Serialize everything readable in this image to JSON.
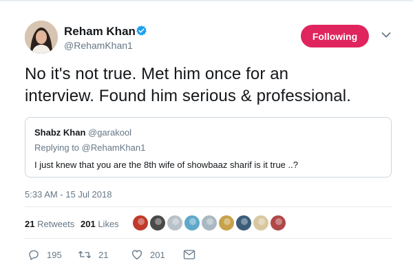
{
  "author": {
    "name": "Reham Khan",
    "handle": "@RehamKhan1",
    "verified": true,
    "avatar_icon": "profile-photo"
  },
  "follow_button": {
    "label": "Following",
    "color": "#e0245e"
  },
  "menu": {
    "icon": "chevron-down-icon"
  },
  "tweet": {
    "text_line1": "No it's not true. Met him once for an",
    "text_line2": "interview. Found him serious & professional."
  },
  "quoted_tweet": {
    "name": "Shabz Khan",
    "handle": "@garakool",
    "replying_to": "Replying to @RehamKhan1",
    "text": "I just knew that you are the 8th wife of showbaaz sharif is it true ..?"
  },
  "timestamp": "5:33 AM - 15 Jul 2018",
  "stats": {
    "retweets_count": "21",
    "retweets_label": "Retweets",
    "likes_count": "201",
    "likes_label": "Likes"
  },
  "likers": [
    {
      "name": "liker-1",
      "color": "#c0392b"
    },
    {
      "name": "liker-2",
      "color": "#4a4a4a"
    },
    {
      "name": "liker-3",
      "color": "#b8c2c8"
    },
    {
      "name": "liker-4",
      "color": "#5fa8c9"
    },
    {
      "name": "liker-5",
      "color": "#aab8c2"
    },
    {
      "name": "liker-6",
      "color": "#c7a24a"
    },
    {
      "name": "liker-7",
      "color": "#3b5d7a"
    },
    {
      "name": "liker-8",
      "color": "#d9c7a0"
    },
    {
      "name": "liker-9",
      "color": "#b04848"
    }
  ],
  "actions": {
    "replies": "195",
    "retweets": "21",
    "likes": "201"
  },
  "colors": {
    "secondary_text": "#657786",
    "verified_blue": "#1da1f2"
  }
}
